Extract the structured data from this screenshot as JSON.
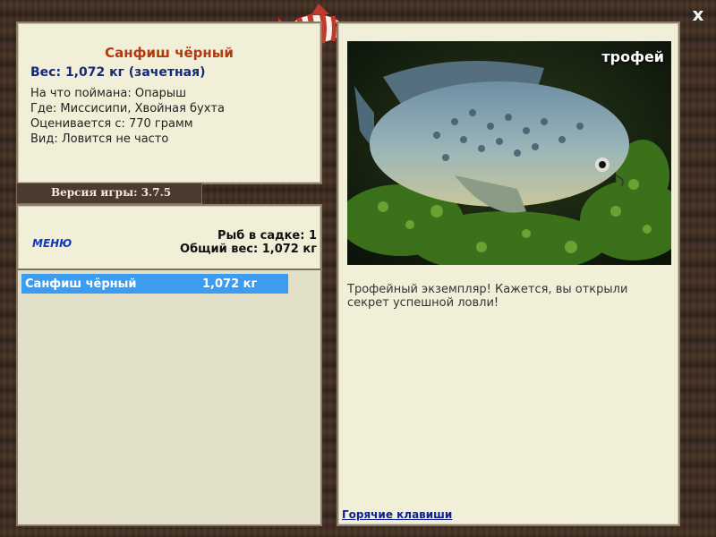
{
  "window": {
    "close_symbol": "x"
  },
  "fish": {
    "name": "Санфиш чёрный",
    "weight_line": "Вес: 1,072 кг (зачетная)",
    "bait": "На что поймана: Опарыш",
    "location": "Где: Миссисипи, Хвойная бухта",
    "rated_from": "Оценивается с: 770 грамм",
    "kind": "Вид: Ловится не часто"
  },
  "version": {
    "label": "Версия игры: 3.7.5"
  },
  "menu": {
    "label": "МЕНЮ"
  },
  "cage": {
    "count_line": "Рыб в садке: 1",
    "total_line": "Общий вес: 1,072 кг",
    "rows": [
      {
        "name": "Санфиш чёрный",
        "weight": "1,072 кг"
      }
    ]
  },
  "photo": {
    "badge": "трофей"
  },
  "description": "Трофейный экземпляр! Кажется, вы открыли секрет успешной ловли!",
  "hotkeys": {
    "label": "Горячие клавиши"
  },
  "colors": {
    "name": "#b23a10",
    "weight": "#16287a",
    "row_highlight": "#3c9cf0",
    "menu": "#1038c8"
  },
  "icons": {
    "logo": "striped-fish-logo",
    "close": "close-icon"
  }
}
